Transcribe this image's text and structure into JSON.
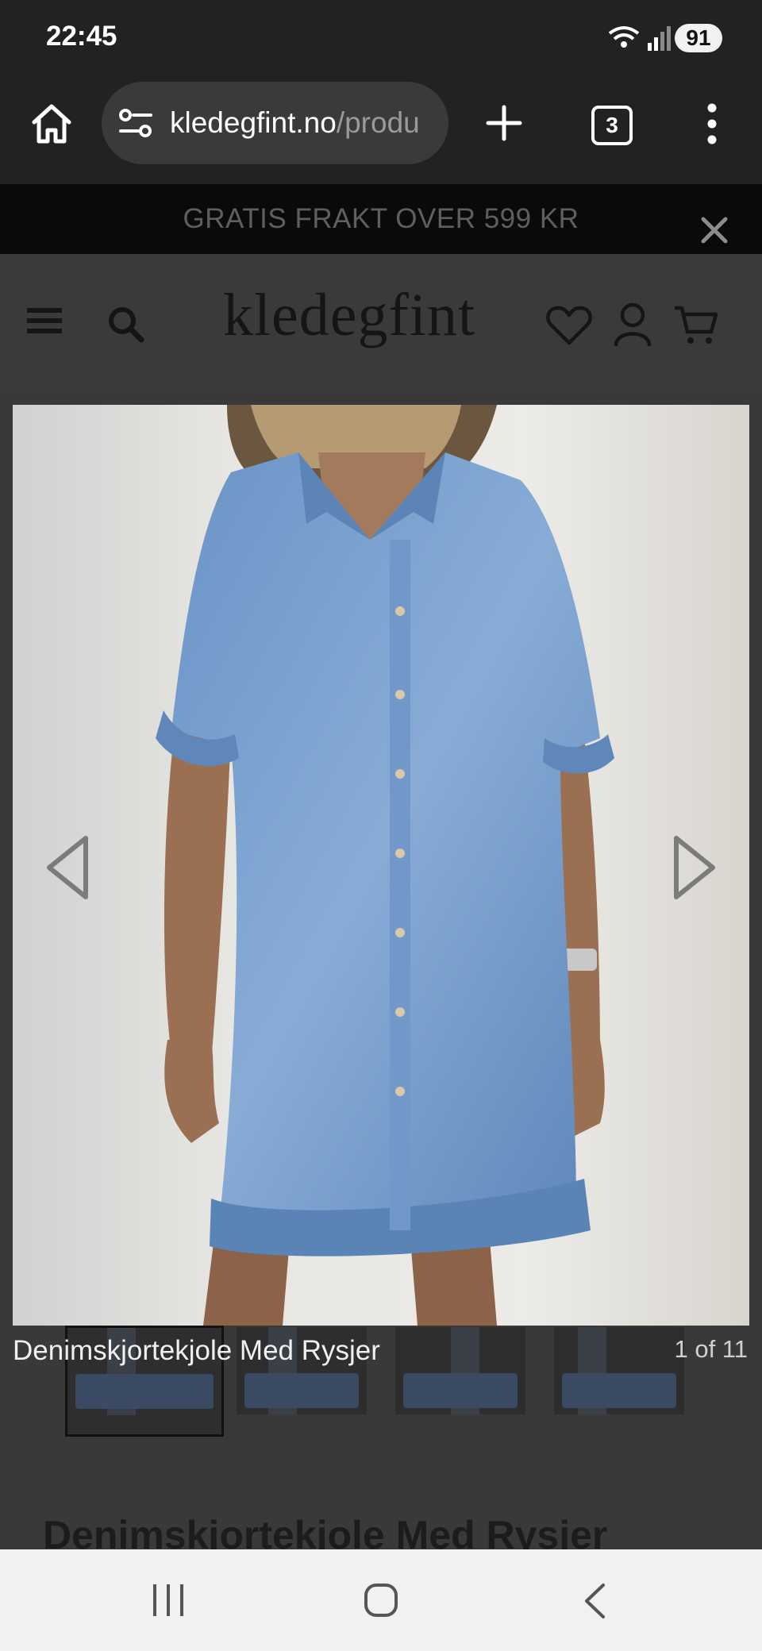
{
  "status_bar": {
    "time": "22:45",
    "battery": "91"
  },
  "browser": {
    "url_host": "kledegfint.no",
    "url_path": "/produ",
    "tab_count": "3"
  },
  "promo": {
    "text": "GRATIS FRAKT OVER 599 KR"
  },
  "site": {
    "logo": "kledegfint"
  },
  "product": {
    "image_caption": "Denimskjortekjole Med Rysjer",
    "image_counter": "1 of 11",
    "title": "Denimskjortekjole Med Rysjer"
  },
  "colors": {
    "status_bar": "#222222",
    "overlay": "#393939",
    "denim": "#6e96c4",
    "nav_bar": "#f1f1f4"
  }
}
